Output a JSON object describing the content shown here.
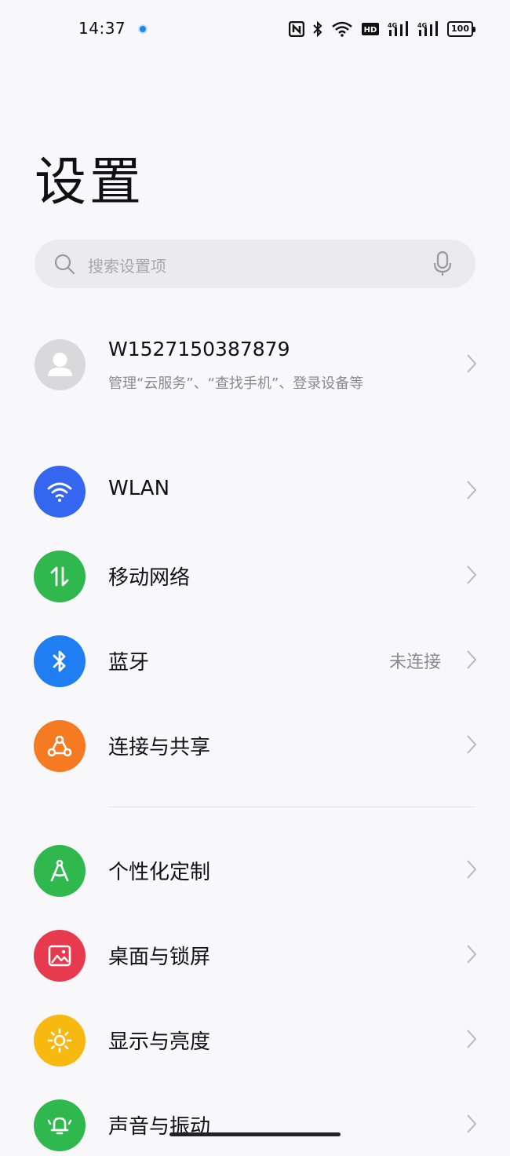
{
  "status_bar": {
    "time": "14:37",
    "battery": "100",
    "icons": [
      "nfc-icon",
      "bluetooth-icon",
      "wifi-icon",
      "hd-icon",
      "signal-icon",
      "signal-icon"
    ]
  },
  "page": {
    "title": "设置"
  },
  "search": {
    "placeholder": "搜索设置项"
  },
  "account": {
    "name": "W1527150387879",
    "subtitle": "管理“云服务”、“查找手机”、登录设备等"
  },
  "items": [
    {
      "label": "WLAN",
      "value": "",
      "icon": "wifi-icon",
      "color": "#3566f0"
    },
    {
      "label": "移动网络",
      "value": "",
      "icon": "mobile-data-icon",
      "color": "#2fb84e"
    },
    {
      "label": "蓝牙",
      "value": "未连接",
      "icon": "bluetooth-icon",
      "color": "#1f7ff2"
    },
    {
      "label": "连接与共享",
      "value": "",
      "icon": "share-icon",
      "color": "#f57a22"
    },
    {
      "label": "个性化定制",
      "value": "",
      "icon": "personalize-icon",
      "color": "#2fb84e"
    },
    {
      "label": "桌面与锁屏",
      "value": "",
      "icon": "wallpaper-icon",
      "color": "#e83a4f"
    },
    {
      "label": "显示与亮度",
      "value": "",
      "icon": "brightness-icon",
      "color": "#f7b90f"
    },
    {
      "label": "声音与振动",
      "value": "",
      "icon": "sound-icon",
      "color": "#2fb84e"
    }
  ]
}
